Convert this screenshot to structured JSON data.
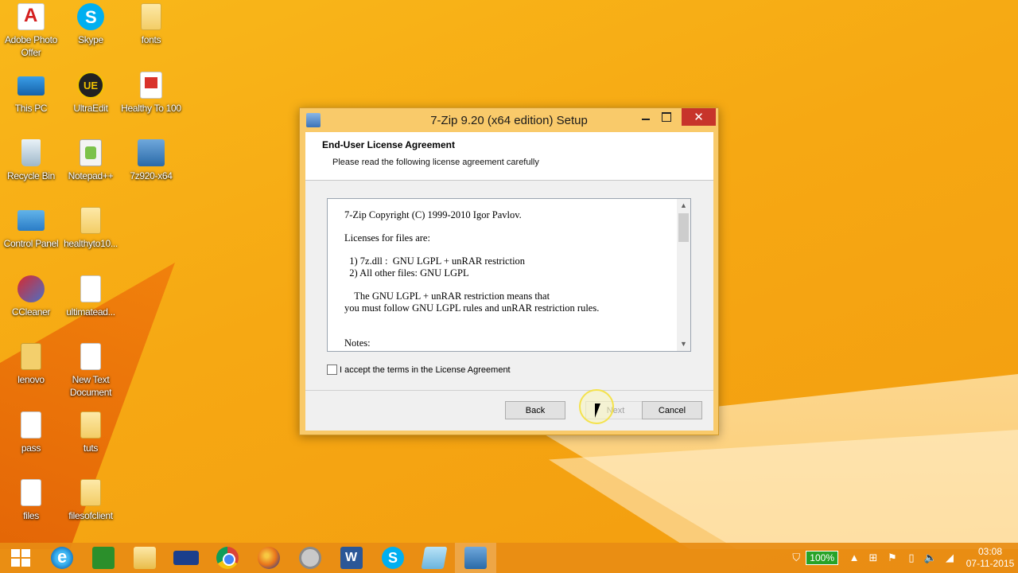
{
  "desktop": {
    "icons": [
      {
        "label": "Adobe Photo Offer",
        "icon": "adobe-icon"
      },
      {
        "label": "Skype",
        "icon": "skype-icon"
      },
      {
        "label": "fonts",
        "icon": "folder-icon"
      },
      {
        "label": "This PC",
        "icon": "computer-icon"
      },
      {
        "label": "UltraEdit",
        "icon": "ultraedit-icon"
      },
      {
        "label": "Healthy To 100",
        "icon": "document-icon"
      },
      {
        "label": "Recycle Bin",
        "icon": "recycle-bin-icon"
      },
      {
        "label": "Notepad++",
        "icon": "notepad-plus-icon"
      },
      {
        "label": "7z920-x64",
        "icon": "installer-icon"
      },
      {
        "label": "Control Panel",
        "icon": "control-panel-icon"
      },
      {
        "label": "healthyto10...",
        "icon": "folder-icon"
      },
      {
        "label": "CCleaner",
        "icon": "ccleaner-icon"
      },
      {
        "label": "ultimatead...",
        "icon": "document-icon"
      },
      {
        "label": "lenovo",
        "icon": "zip-folder-icon"
      },
      {
        "label": "New Text Document",
        "icon": "text-document-icon"
      },
      {
        "label": "pass",
        "icon": "file-icon"
      },
      {
        "label": "tuts",
        "icon": "folder-icon"
      },
      {
        "label": "files",
        "icon": "file-icon"
      },
      {
        "label": "filesofclient",
        "icon": "folder-icon"
      }
    ]
  },
  "dialog": {
    "title": "7-Zip 9.20 (x64 edition) Setup",
    "header_title": "End-User License Agreement",
    "header_subtitle": "Please read the following license agreement carefully",
    "license_text": "7-Zip Copyright (C) 1999-2010 Igor Pavlov.\n\nLicenses for files are:\n\n  1) 7z.dll :  GNU LGPL + unRAR restriction\n  2) All other files: GNU LGPL\n\n    The GNU LGPL + unRAR restriction means that\nyou must follow GNU LGPL rules and unRAR restriction rules.\n\n\nNotes:",
    "accept_label": "I accept the terms in the License Agreement",
    "accept_checked": false,
    "back_label": "Back",
    "next_label": "Next",
    "cancel_label": "Cancel"
  },
  "taskbar": {
    "apps": [
      "start-icon",
      "internet-explorer-icon",
      "store-icon",
      "file-explorer-icon",
      "lenovo-icon",
      "chrome-icon",
      "firefox-icon",
      "ccleaner-icon",
      "word-icon",
      "skype-icon",
      "notepad-icon",
      "setup-icon"
    ],
    "battery": "100%",
    "time": "03:08",
    "date": "07-11-2015"
  },
  "colors": {
    "wallpaper": "#f6a813",
    "close_button": "#c7342b",
    "dialog_frame": "#f9ca6a"
  }
}
